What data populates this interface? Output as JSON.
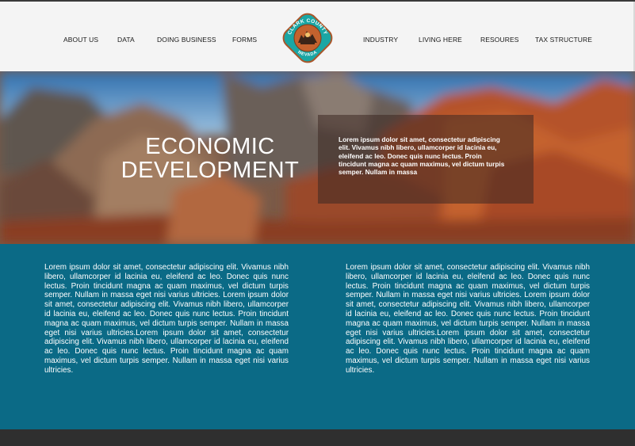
{
  "nav": {
    "left": [
      {
        "label": "ABOUT US"
      },
      {
        "label": "DATA"
      },
      {
        "label": "DOING BUSINESS"
      },
      {
        "label": "FORMS"
      }
    ],
    "right": [
      {
        "label": "INDUSTRY"
      },
      {
        "label": "LIVING HERE"
      },
      {
        "label": "RESOURES"
      },
      {
        "label": "TAX STRUCTURE"
      }
    ]
  },
  "logo": {
    "top_text": "CLARK COUNTY",
    "bottom_text": "NEVADA",
    "colors": {
      "ring": "#1aa6a4",
      "center": "#c4622e",
      "border": "#b45a2a"
    }
  },
  "hero": {
    "title_line1": "ECONOMIC",
    "title_line2": "DEVELOPMENT",
    "box_text": "Lorem ipsum dolor sit amet, consectetur adipiscing elit. Vivamus nibh libero, ullamcorper id lacinia eu, eleifend ac leo. Donec quis nunc lectus. Proin tincidunt magna ac quam maximus, vel dictum turpis semper. Nullam in massa"
  },
  "content": {
    "left_text": "Lorem ipsum dolor sit amet, consectetur adipiscing elit. Vivamus nibh libero, ullamcorper id lacinia eu, eleifend ac leo. Donec quis nunc lectus. Proin tincidunt magna ac quam maximus, vel dictum turpis semper. Nullam in massa eget nisi varius ultricies. Lorem ipsum dolor sit amet, consectetur adipiscing elit. Vivamus nibh libero, ullamcorper id lacinia eu, eleifend ac leo. Donec quis nunc lectus. Proin tincidunt magna ac quam maximus, vel dictum turpis semper. Nullam in massa eget nisi varius ultricies.Lorem ipsum dolor sit amet, consectetur adipiscing elit. Vivamus nibh libero, ullamcorper id lacinia eu, eleifend ac leo. Donec quis nunc lectus. Proin tincidunt magna ac quam maximus, vel dictum turpis semper. Nullam in massa eget nisi varius ultricies.",
    "right_text": "Lorem ipsum dolor sit amet, consectetur adipiscing elit. Vivamus nibh libero, ullamcorper id lacinia eu, eleifend ac leo. Donec quis nunc lectus. Proin tincidunt magna ac quam maximus, vel dictum turpis semper. Nullam in massa eget nisi varius ultricies. Lorem ipsum dolor sit amet, consectetur adipiscing elit. Vivamus nibh libero, ullamcorper id lacinia eu, eleifend ac leo. Donec quis nunc lectus. Proin tincidunt magna ac quam maximus, vel dictum turpis semper. Nullam in massa eget nisi varius ultricies.Lorem ipsum dolor sit amet, consectetur adipiscing elit. Vivamus nibh libero, ullamcorper id lacinia eu, eleifend ac leo. Donec quis nunc lectus. Proin tincidunt magna ac quam maximus, vel dictum turpis semper. Nullam in massa eget nisi varius ultricies."
  },
  "colors": {
    "header_bg": "#f4f4f4",
    "content_bg": "#0b6a86",
    "footer_bg": "#2f2f2f"
  }
}
